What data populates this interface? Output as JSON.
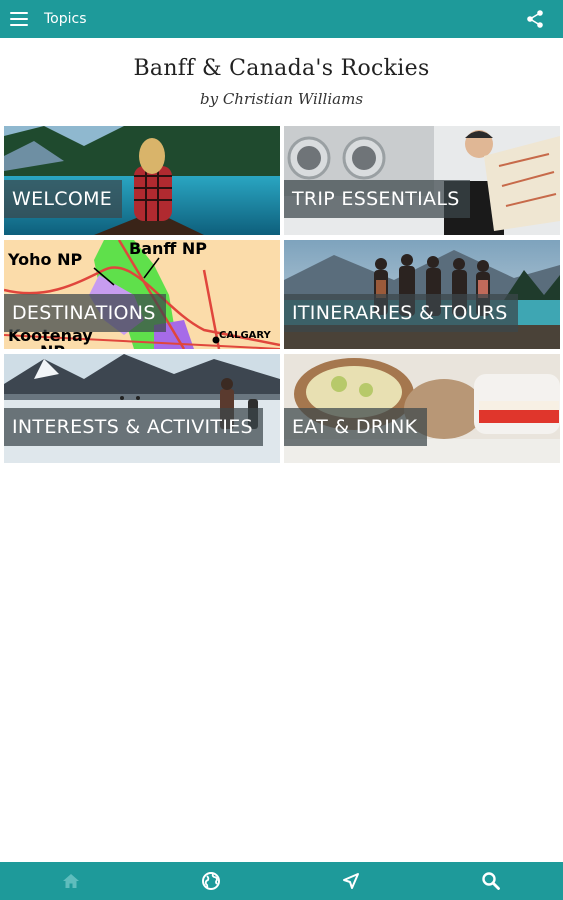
{
  "appbar": {
    "title": "Topics",
    "menu_icon": "menu-icon",
    "share_icon": "share-icon",
    "color": "#1e9a9a"
  },
  "book": {
    "title": "Banff & Canada's Rockies",
    "author": "by Christian Williams"
  },
  "tiles": [
    {
      "label": "WELCOME"
    },
    {
      "label": "TRIP ESSENTIALS"
    },
    {
      "label": "DESTINATIONS",
      "map_labels": [
        "Yoho NP",
        "Banff NP",
        "Kootenay",
        "NP",
        "CALGARY"
      ]
    },
    {
      "label": "ITINERARIES & TOURS"
    },
    {
      "label": "INTERESTS & ACTIVITIES"
    },
    {
      "label": "EAT & DRINK"
    }
  ],
  "bottom_nav": [
    {
      "icon": "home-icon",
      "active": false
    },
    {
      "icon": "globe-icon",
      "active": true
    },
    {
      "icon": "location-arrow-icon",
      "active": true
    },
    {
      "icon": "search-icon",
      "active": true
    }
  ]
}
